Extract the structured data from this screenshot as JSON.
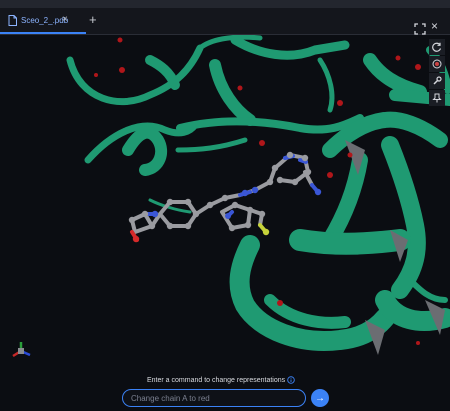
{
  "tab": {
    "label": "Sceo_2_.pdb",
    "close": "×"
  },
  "tab_add": "+",
  "window_close": "×",
  "toolbar": {
    "tools": [
      "rotate-icon",
      "target-icon",
      "wrench-icon",
      "pin-icon"
    ]
  },
  "command": {
    "label": "Enter a command to change representations",
    "placeholder": "Change chain A to red",
    "send": "→"
  },
  "colors": {
    "ribbon": "#1f9a72",
    "accent": "#3b82f6",
    "water": "#b0161a",
    "carbon": "#9a9ba0",
    "nitrogen": "#3a56d6",
    "oxygen": "#d62a2a",
    "sulfur": "#c6d23a"
  }
}
